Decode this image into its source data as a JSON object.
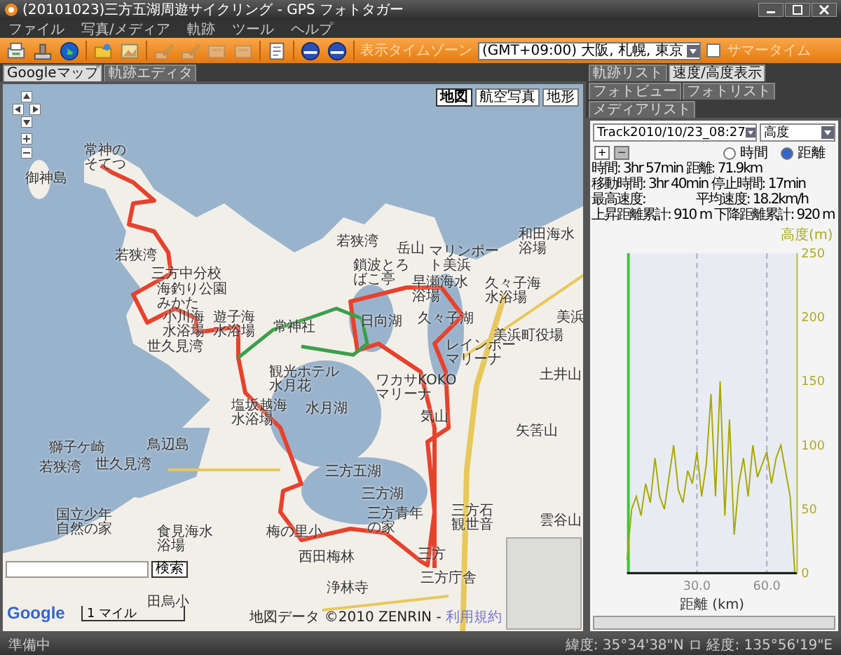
{
  "window": {
    "title": "(20101023)三方五湖周遊サイクリング - GPS フォトタガー"
  },
  "menu": [
    "ファイル",
    "写真/メディア",
    "軌跡",
    "ツール",
    "ヘルプ"
  ],
  "toolbar": {
    "buttons": [
      {
        "kind": "document",
        "disabled": false
      },
      {
        "kind": "stamp",
        "disabled": false
      },
      {
        "kind": "globe",
        "disabled": false
      },
      {
        "kind": "folder",
        "disabled": false
      },
      {
        "kind": "picture",
        "disabled": false
      },
      {
        "kind": "pencil",
        "disabled": true
      },
      {
        "kind": "pencil",
        "disabled": true
      },
      {
        "kind": "card",
        "disabled": true
      },
      {
        "kind": "card",
        "disabled": true
      },
      {
        "kind": "page",
        "disabled": false
      },
      {
        "kind": "orb",
        "disabled": false
      },
      {
        "kind": "orb",
        "disabled": false
      }
    ],
    "timezone_label": "表示タイムゾーン",
    "timezone_value": "(GMT+09:00) 大阪, 札幌, 東京",
    "summer_time": {
      "label": "サマータイム",
      "checked": false
    }
  },
  "left_tabs": [
    {
      "label": "Googleマップ",
      "selected": true
    },
    {
      "label": "軌跡エディタ",
      "selected": false
    }
  ],
  "map": {
    "map_types": [
      {
        "label": "地図",
        "selected": true
      },
      {
        "label": "航空写真",
        "selected": false
      },
      {
        "label": "地形",
        "selected": false
      }
    ],
    "labels": [
      "御神島",
      "常神のそてつ",
      "若狭湾",
      "三方中分校",
      "海釣り公園みかた",
      "小川海水浴場",
      "遊子海水浴場",
      "世久見湾",
      "常神社",
      "観光ホテル水月花",
      "塩坂越海水浴場",
      "若狭湾",
      "岳山",
      "マリンポート美浜",
      "和田海水浴場",
      "鎖波とろばこ亭",
      "早瀬海水浴場",
      "久々子海水浴場",
      "日向湖",
      "久々子湖",
      "美浜",
      "美浜町役場",
      "レインボーマリーナ",
      "土井山",
      "ワカサKOKOマリーナ",
      "水月湖",
      "気山",
      "矢筈山",
      "獅子ケ崎",
      "鳥辺島",
      "若狭湾",
      "世久見湾",
      "三方五湖",
      "三方湖",
      "国立少年自然の家",
      "三方青年の家",
      "三方石観世音",
      "食見海水浴場",
      "梅の里小",
      "西田梅林",
      "雲谷山",
      "三方",
      "三方庁舎",
      "浄林寺",
      "田烏小"
    ],
    "search_button": "検索",
    "logo": "Google",
    "scale": "1 マイル",
    "attribution": "地図データ ©2010 ZENRIN -",
    "terms_link": "利用規約"
  },
  "right_tabs": [
    {
      "label": "軌跡リスト",
      "selected": false
    },
    {
      "label": "速度/高度表示",
      "selected": true
    },
    {
      "label": "フォトビュー",
      "selected": false
    },
    {
      "label": "フォトリスト",
      "selected": false
    },
    {
      "label": "メディアリスト",
      "selected": false
    }
  ],
  "track_select": "Track2010/10/23_08:27",
  "metric_select": "高度",
  "zoom_buttons": [
    {
      "label": "+",
      "disabled": false
    },
    {
      "label": "−",
      "disabled": true
    }
  ],
  "axis_mode": [
    {
      "label": "時間",
      "selected": false
    },
    {
      "label": "距離",
      "selected": true
    }
  ],
  "stats": [
    "時間: 3hr 57min 距離: 71.9km",
    "移動時間: 3hr 40min 停止時間: 17min",
    "最高速度:　　　　平均速度: 18.2km/h",
    "上昇距離累計: 910 m 下降距離累計: 920 m"
  ],
  "chart_data": {
    "type": "line",
    "xlabel": "距離 (km)",
    "ylabel": "高度(m)",
    "x": [
      0,
      2,
      4,
      6,
      8,
      10,
      12,
      14,
      16,
      18,
      20,
      22,
      24,
      26,
      28,
      30,
      32,
      34,
      36,
      38,
      40,
      42,
      44,
      46,
      48,
      50,
      52,
      54,
      56,
      58,
      60,
      62,
      64,
      66,
      68,
      70,
      72
    ],
    "series": [
      {
        "color": "#a8a800",
        "values": [
          10,
          50,
          60,
          45,
          70,
          55,
          90,
          60,
          50,
          75,
          100,
          65,
          55,
          80,
          70,
          95,
          60,
          85,
          140,
          60,
          150,
          45,
          120,
          30,
          70,
          90,
          60,
          100,
          75,
          85,
          95,
          70,
          90,
          100,
          80,
          60,
          0
        ]
      }
    ],
    "xlim": [
      0,
      73
    ],
    "ylim": [
      0,
      250
    ],
    "xticks": [
      {
        "value": 30,
        "label": "30.0"
      },
      {
        "value": 60,
        "label": "60.0"
      }
    ],
    "yticks": [
      0,
      50,
      100,
      150,
      200,
      250
    ]
  },
  "status_bar": {
    "left": "準備中",
    "right": "緯度: 35°34'38\"N ロ 経度: 135°56'19\"E"
  }
}
